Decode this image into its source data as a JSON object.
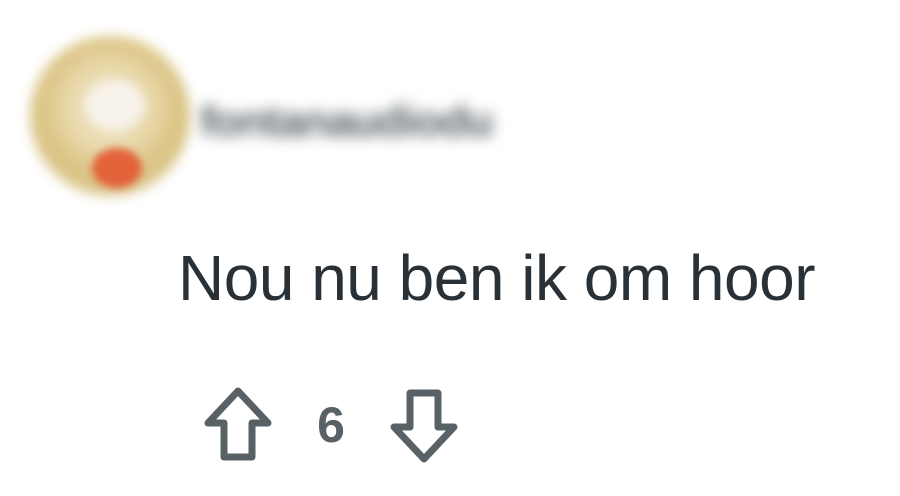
{
  "comment": {
    "author": "fontanaudiodu",
    "text": "Nou nu ben ik om hoor",
    "score": "6"
  },
  "icons": {
    "upvote": "arrow-up-outline-icon",
    "downvote": "arrow-down-outline-icon"
  },
  "colors": {
    "text": "#2a3136",
    "muted": "#586166",
    "avatar_badge": "#e3623a"
  }
}
